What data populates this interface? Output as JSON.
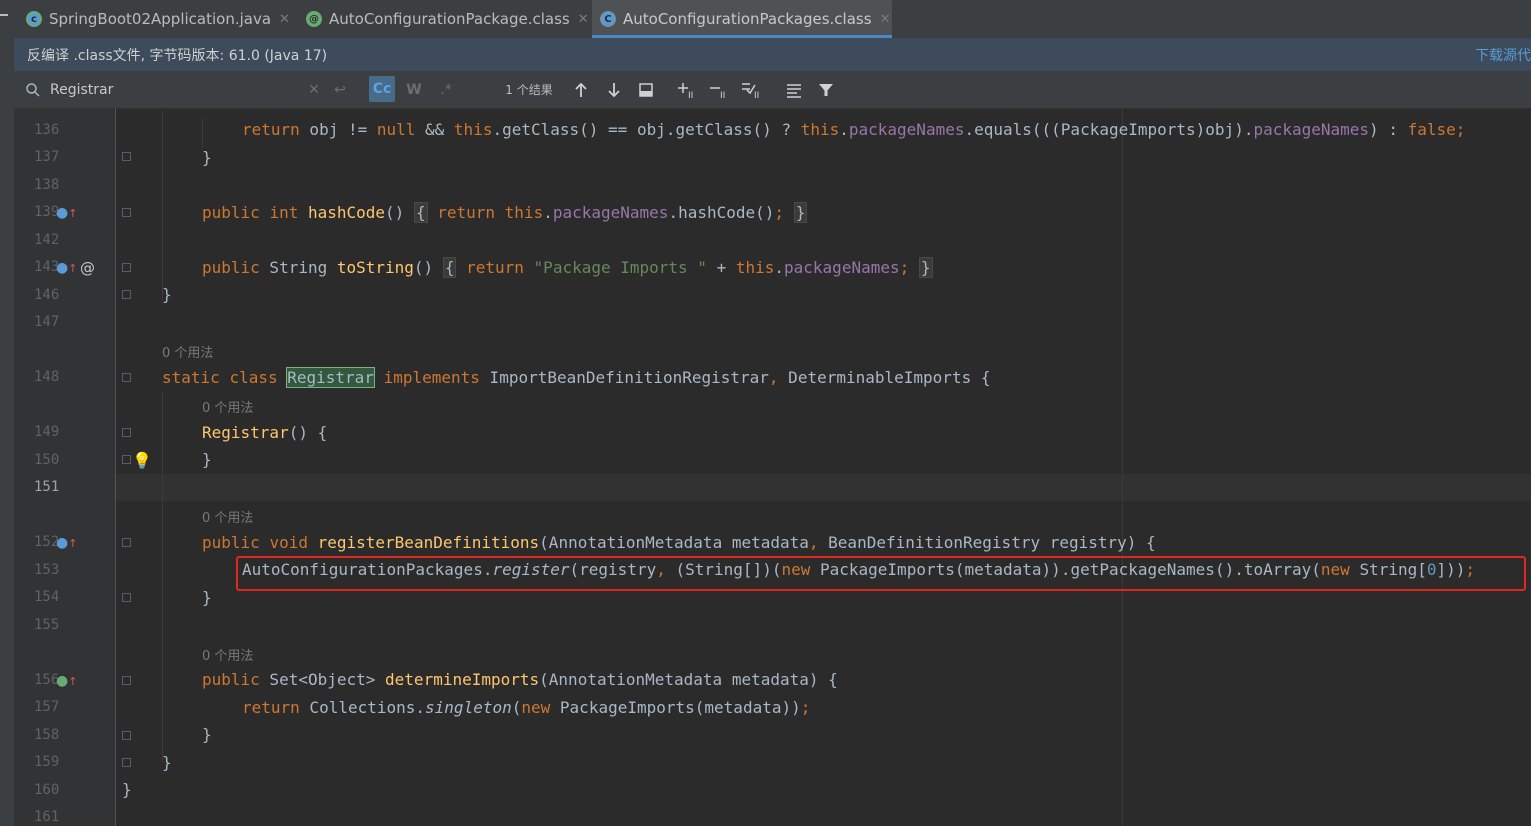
{
  "tabs": [
    {
      "label": "SpringBoot02Application.java",
      "icon": "spring-class-icon",
      "active": false
    },
    {
      "label": "AutoConfigurationPackage.class",
      "icon": "annotation-icon",
      "active": false
    },
    {
      "label": "AutoConfigurationPackages.class",
      "icon": "class-icon",
      "active": true
    }
  ],
  "banner": {
    "text": "反编译 .class文件, 字节码版本: 61.0 (Java 17)",
    "link": "下载源代"
  },
  "find": {
    "query": "Registrar",
    "results": "1 个结果",
    "match_case": "Cc",
    "words": "W",
    "regex": ".*"
  },
  "usage_hint": "0 个用法",
  "line_numbers": [
    "136",
    "137",
    "138",
    "139",
    "142",
    "143",
    "146",
    "147",
    "148",
    "149",
    "150",
    "151",
    "152",
    "153",
    "154",
    "155",
    "156",
    "157",
    "158",
    "159",
    "160",
    "161"
  ],
  "code": {
    "l136": {
      "ret": "return",
      "a": " obj != ",
      "null": "null",
      "b": " && ",
      "this1": "this",
      "c": ".getClass() == obj.getClass() ? ",
      "this2": "this",
      "d": ".",
      "fld": "packageNames",
      "e": ".equals(((PackageImports)obj).",
      "fld2": "packageNames",
      "f": ") : ",
      "false": "false",
      "semi": ";"
    },
    "l137": "}",
    "l139": {
      "pub": "public",
      "int": "int",
      "name": "hashCode",
      "p": "()",
      "ret": "return",
      "this": "this",
      "dot": ".",
      "fld": "packageNames",
      "rest": ".hashCode()",
      "semi": ";",
      "close": "}",
      "open": "{"
    },
    "l143": {
      "pub": "public",
      "type": " String ",
      "name": "toString",
      "p": "()",
      "open": "{",
      "ret": "return",
      "str": "\"Package Imports \"",
      "plus": " + ",
      "this": "this",
      "dot": ".",
      "fld": "packageNames",
      "semi": ";",
      "close": "}"
    },
    "l146": "}",
    "l148": {
      "static": "static",
      "class": "class",
      "name": "Registrar",
      "impl": "implements",
      "rest": " ImportBeanDefinitionRegistrar",
      "comma": ",",
      "rest2": " DeterminableImports {"
    },
    "l149": {
      "name": "Registrar",
      "rest": "() {"
    },
    "l150": "}",
    "l152": {
      "pub": "public",
      "void": "void",
      "name": "registerBeanDefinitions",
      "rest": "(AnnotationMetadata metadata",
      "comma": ",",
      "rest2": " BeanDefinitionRegistry registry) {"
    },
    "l153": {
      "a": "AutoConfigurationPackages.",
      "reg": "register",
      "b": "(registry",
      "comma": ",",
      "c": " (String[])(",
      "new1": "new",
      "d": " PackageImports(metadata)).getPackageNames().toArray(",
      "new2": "new",
      "e": " String[",
      "zero": "0",
      "f": "]))",
      "semi": ";"
    },
    "l154": "}",
    "l156": {
      "pub": "public",
      "rest": " Set<Object> ",
      "name": "determineImports",
      "rest2": "(AnnotationMetadata metadata) {"
    },
    "l157": {
      "ret": "return",
      "a": " Collections.",
      "single": "singleton",
      "b": "(",
      "new": "new",
      "c": " PackageImports(metadata))",
      "semi": ";"
    },
    "l158": "}",
    "l159": "}",
    "l160": "}"
  },
  "colors": {
    "keyword": "#cc7832",
    "method": "#ffc66d",
    "field": "#9876aa",
    "string": "#6a8759",
    "number": "#6897bb",
    "highlight_box": "#e0281f"
  }
}
